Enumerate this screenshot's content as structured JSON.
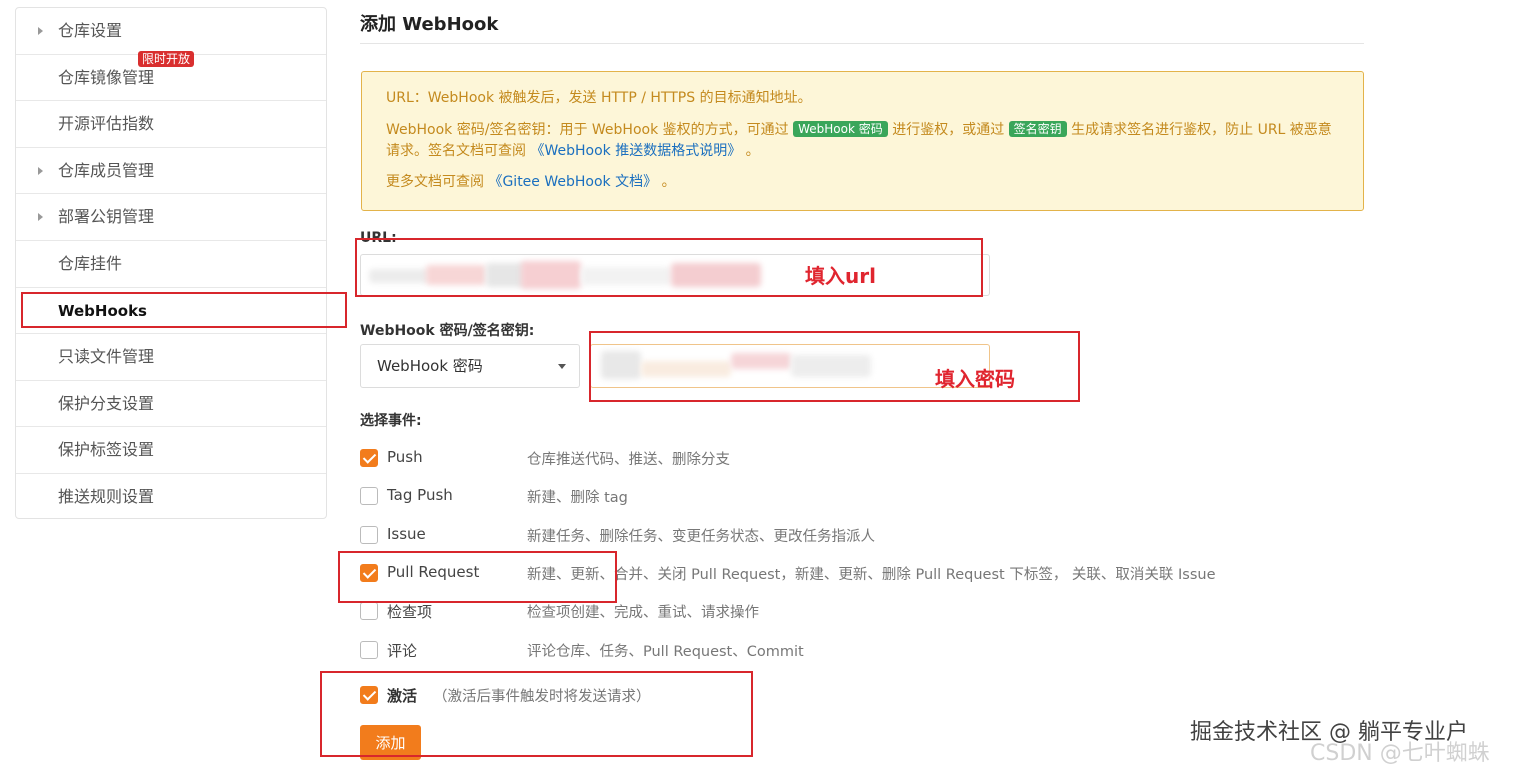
{
  "sidebar": {
    "items": [
      {
        "label": "仓库设置",
        "expandable": true
      },
      {
        "label": "仓库镜像管理",
        "expandable": false,
        "badge": "限时开放"
      },
      {
        "label": "开源评估指数",
        "expandable": false
      },
      {
        "label": "仓库成员管理",
        "expandable": true
      },
      {
        "label": "部署公钥管理",
        "expandable": true
      },
      {
        "label": "仓库挂件",
        "expandable": false
      },
      {
        "label": "WebHooks",
        "expandable": false,
        "active": true
      },
      {
        "label": "只读文件管理",
        "expandable": false
      },
      {
        "label": "保护分支设置",
        "expandable": false
      },
      {
        "label": "保护标签设置",
        "expandable": false
      },
      {
        "label": "推送规则设置",
        "expandable": false
      }
    ]
  },
  "main": {
    "title": "添加 WebHook",
    "notice": {
      "line1": "URL：WebHook 被触发后，发送 HTTP / HTTPS 的目标通知地址。",
      "line2_a": "WebHook 密码/签名密钥：用于 WebHook 鉴权的方式，可通过",
      "tag_password": "WebHook 密码",
      "line2_b": "进行鉴权，或通过",
      "tag_sign": "签名密钥",
      "line2_c": "生成请求签名进行鉴权，防止 URL 被恶意请求。签名文档可查阅",
      "doc_link_1": "《WebHook 推送数据格式说明》",
      "line2_end": "。",
      "line3_a": "更多文档可查阅",
      "doc_link_2": "《Gitee WebHook 文档》",
      "line3_end": "。"
    },
    "url_label": "URL:",
    "secret_label": "WebHook 密码/签名密钥:",
    "secret_type_selected": "WebHook 密码",
    "events_label": "选择事件:",
    "events": [
      {
        "name": "Push",
        "desc": "仓库推送代码、推送、删除分支",
        "checked": true
      },
      {
        "name": "Tag Push",
        "desc": "新建、删除 tag",
        "checked": false
      },
      {
        "name": "Issue",
        "desc": "新建任务、删除任务、变更任务状态、更改任务指派人",
        "checked": false
      },
      {
        "name": "Pull Request",
        "desc": "新建、更新、合并、关闭 Pull Request，新建、更新、删除 Pull Request 下标签， 关联、取消关联 Issue",
        "checked": true
      },
      {
        "name": "检查项",
        "desc": "检查项创建、完成、重试、请求操作",
        "checked": false
      },
      {
        "name": "评论",
        "desc": "评论仓库、任务、Pull Request、Commit",
        "checked": false
      }
    ],
    "activate": {
      "label": "激活",
      "hint": "（激活后事件触发时将发送请求）",
      "checked": true
    },
    "submit_label": "添加"
  },
  "annotations": {
    "url_hint": "填入url",
    "secret_hint": "填入密码"
  },
  "watermark": {
    "main": "掘金技术社区 @ 躺平专业户",
    "faint": "CSDN @七叶蜘蛛"
  },
  "colors": {
    "accent": "#f27c1c",
    "notice_bg": "#fdf6d8",
    "notice_border": "#e3b34a",
    "notice_text": "#c48a1e",
    "link": "#1a6fbf",
    "tag_green": "#3aa65a",
    "badge_red": "#d92f2f",
    "annotation_red": "#d8262c"
  }
}
